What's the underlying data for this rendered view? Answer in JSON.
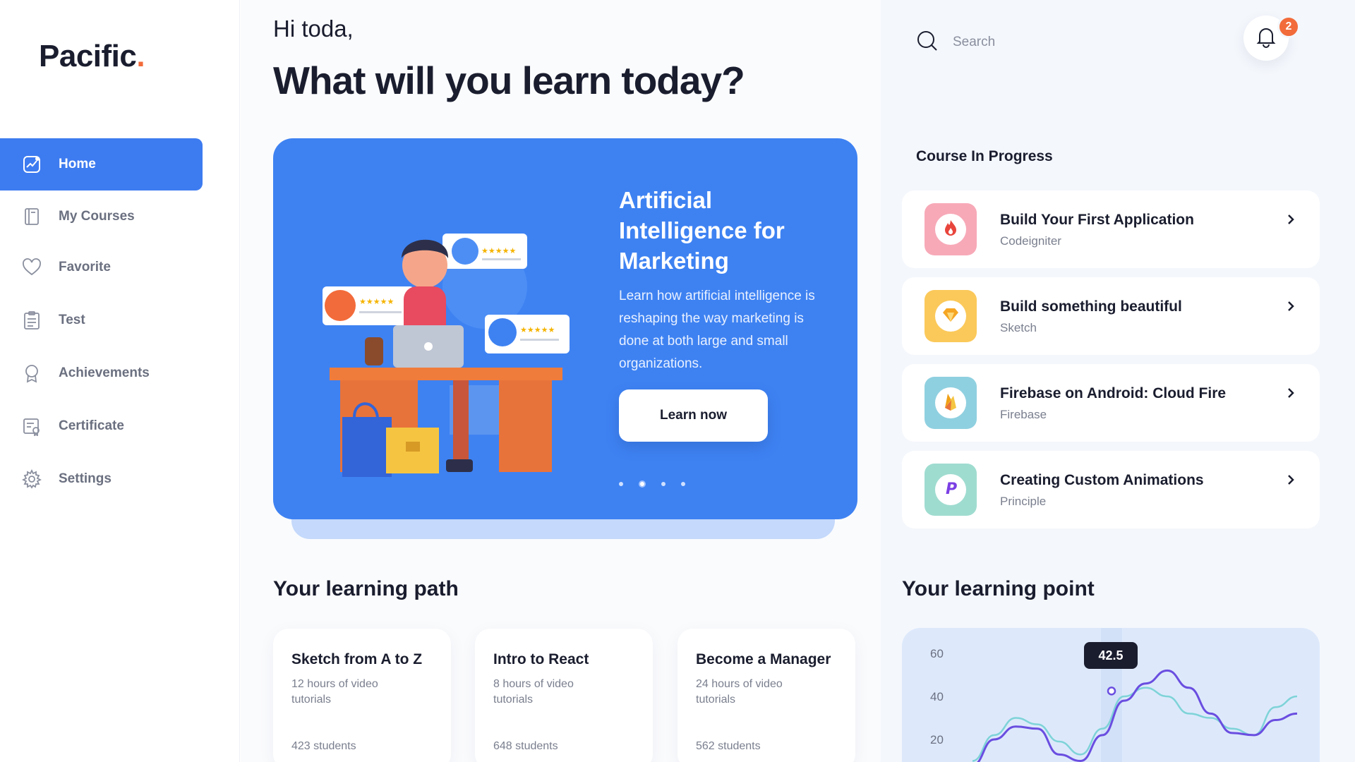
{
  "app": {
    "logo_text": "Pacific",
    "logo_dot": ".",
    "accent_color": "#3d7bf0",
    "orange_color": "#f26b3a"
  },
  "sidebar": {
    "items": [
      {
        "label": "Home",
        "icon": "chart-icon",
        "active": true
      },
      {
        "label": "My Courses",
        "icon": "book-icon"
      },
      {
        "label": "Favorite",
        "icon": "heart-icon"
      },
      {
        "label": "Test",
        "icon": "clipboard-icon"
      },
      {
        "label": "Achievements",
        "icon": "award-icon"
      },
      {
        "label": "Certificate",
        "icon": "certificate-icon"
      },
      {
        "label": "Settings",
        "icon": "gear-icon"
      }
    ]
  },
  "main": {
    "greeting": "Hi toda,",
    "headline": "What will you learn today?",
    "hero": {
      "title": "Artificial Intelligence for Marketing",
      "description": "Learn how artificial intelligence is reshaping the way marketing is done at both large and small organizations.",
      "button_label": "Learn now",
      "slide_count": 4,
      "active_slide": 2
    },
    "learning_path": {
      "title": "Your learning path",
      "cards": [
        {
          "title": "Sketch from A to Z",
          "hours": "12 hours of video tutorials",
          "students": "423 students"
        },
        {
          "title": "Intro to React",
          "hours": "8 hours of video tutorials",
          "students": "648 students"
        },
        {
          "title": "Become a Manager",
          "hours": "24 hours of video tutorials",
          "students": "562 students"
        }
      ]
    }
  },
  "right": {
    "search_placeholder": "Search",
    "notification_count": "2",
    "course_in_progress_title": "Course In Progress",
    "courses": [
      {
        "name": "Build Your First Application",
        "sub": "Codeigniter",
        "icon": "flame-icon",
        "bg": "#f7a9b8",
        "fg": "#e8453c"
      },
      {
        "name": "Build something beautiful",
        "sub": "Sketch",
        "icon": "diamond-icon",
        "bg": "#fbc95a",
        "fg": "#f5a623"
      },
      {
        "name": "Firebase on Android: Cloud Fire",
        "sub": "Firebase",
        "icon": "fire-icon",
        "bg": "#8fd0e0",
        "fg": "#f0a015"
      },
      {
        "name": "Creating Custom Animations",
        "sub": "Principle",
        "icon": "principle-icon",
        "bg": "#9fdcd0",
        "fg": "#7b3fe4"
      }
    ],
    "learning_point": {
      "title": "Your learning point",
      "tooltip": "42.5"
    }
  },
  "chart_data": {
    "type": "line",
    "title": "Your learning point",
    "y_ticks": [
      "60",
      "40",
      "20"
    ],
    "ylim": [
      10,
      65
    ],
    "grid": false,
    "highlight_value": 42.5,
    "series": [
      {
        "color": "#6a4ee0",
        "values": [
          8,
          20,
          26,
          25,
          13,
          10,
          22,
          38,
          46,
          52,
          44,
          32,
          23,
          22,
          29,
          32
        ]
      },
      {
        "color": "#7ed3d8",
        "values": [
          10,
          22,
          30,
          27,
          19,
          13,
          25,
          40,
          44,
          40,
          32,
          30,
          25,
          22,
          35,
          40
        ]
      }
    ]
  }
}
